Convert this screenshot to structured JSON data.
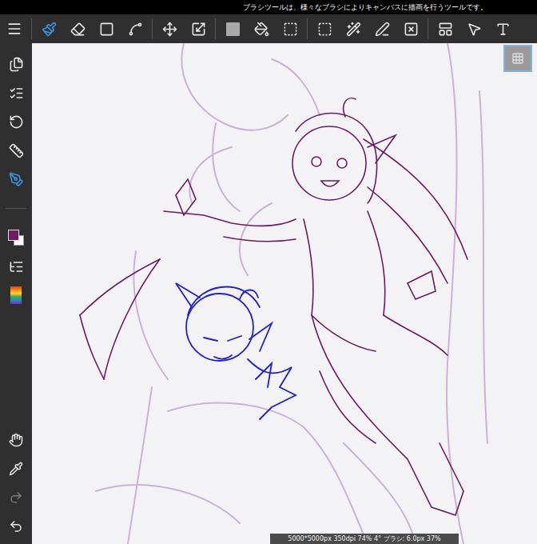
{
  "hint_bar": {
    "text": "ブラシツールは、様々なブラシによりキャンバスに描画を行うツールです。"
  },
  "toolbar": {
    "groups": [
      [
        {
          "selected": false
        }
      ],
      [
        {
          "selected": true
        },
        {
          "selected": false
        },
        {
          "selected": false
        },
        {
          "selected": false
        }
      ],
      [
        {
          "selected": false
        },
        {
          "selected": false
        }
      ],
      [
        {
          "selected": false,
          "color": "#a9a9a9"
        },
        {
          "selected": false
        },
        {
          "selected": false
        }
      ],
      [
        {
          "selected": false
        },
        {
          "selected": false
        },
        {
          "selected": false
        },
        {
          "selected": false
        }
      ],
      [
        {
          "selected": false
        },
        {
          "selected": false
        },
        {
          "selected": false
        }
      ]
    ]
  },
  "sidebar": {
    "top": [
      {
        "selected": false
      },
      {
        "selected": false
      },
      {
        "selected": false
      },
      {
        "selected": false
      },
      {
        "selected": true
      }
    ],
    "colors": {
      "primary": "#6e1b63",
      "secondary": "#ffffff"
    },
    "bottom": [
      {
        "disabled": false
      },
      {
        "disabled": false
      },
      {
        "disabled": true
      },
      {
        "disabled": false
      }
    ]
  },
  "canvas": {
    "grid_button": {
      "selected": true
    }
  },
  "status_bar": {
    "text": "5000*5000px 350dpi 74% 4° ブラシ: 6.0px 37%"
  }
}
